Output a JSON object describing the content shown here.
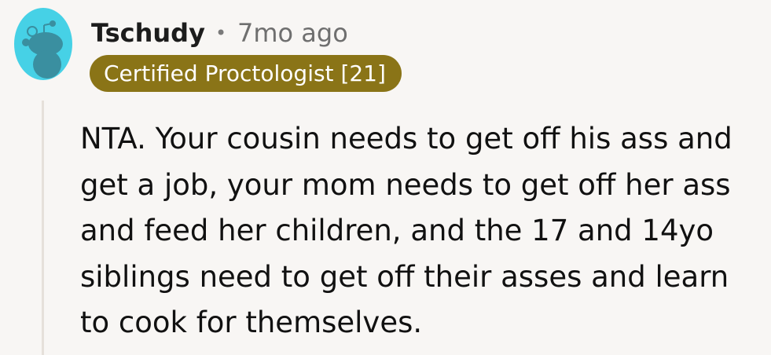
{
  "comment": {
    "author": "Tschudy",
    "separator": "•",
    "timestamp": "7mo ago",
    "flair": "Certified Proctologist [21]",
    "body": "NTA. Your cousin needs to get off his ass and get a job, your mom needs to get off her ass and feed her children, and the 17 and 14yo siblings need to get off their asses and learn to cook for themselves."
  },
  "colors": {
    "background": "#f8f6f4",
    "avatar_background": "#46d1e6",
    "flair_background": "#8a7417",
    "flair_text": "#ffffff",
    "thread_line": "#e6e0da"
  },
  "icons": {
    "avatar": "reddit-snoo-avatar-icon"
  }
}
